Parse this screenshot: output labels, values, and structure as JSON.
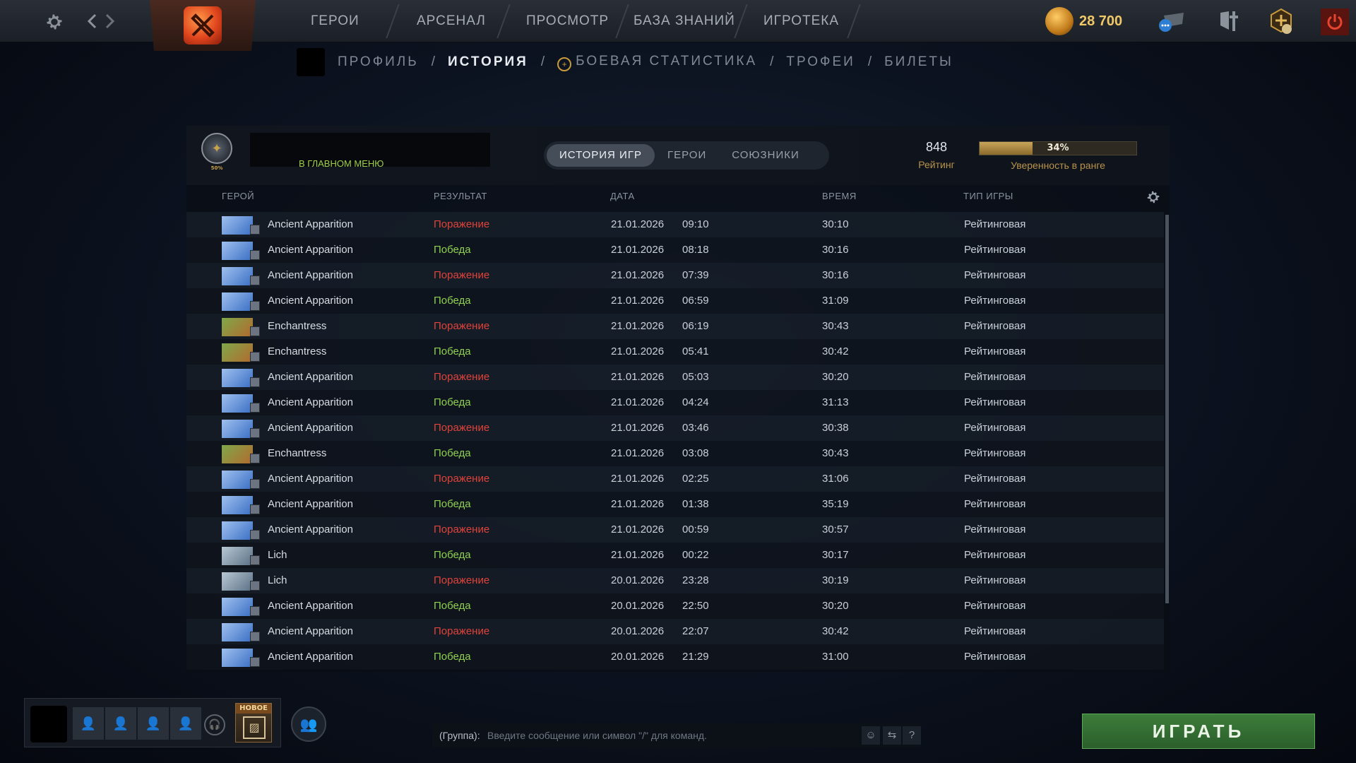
{
  "topbar": {
    "nav": [
      "ГЕРОИ",
      "АРСЕНАЛ",
      "ПРОСМОТР",
      "БАЗА ЗНАНИЙ",
      "ИГРОТЕКА"
    ],
    "currency": "28 700"
  },
  "subnav": {
    "profile": "ПРОФИЛЬ",
    "history": "ИСТОРИЯ",
    "battle_stats": "БОЕВАЯ СТАТИСТИКА",
    "trophies": "ТРОФЕИ",
    "tickets": "БИЛЕТЫ",
    "sep": "/"
  },
  "panel": {
    "medal_percent": "50%",
    "main_menu_link": "В ГЛАВНОМ МЕНЮ",
    "tabs": [
      "ИСТОРИЯ ИГР",
      "ГЕРОИ",
      "СОЮЗНИКИ"
    ],
    "rating_value": "848",
    "rating_label": "Рейтинг",
    "confidence_text": "34%",
    "confidence_value": 0.34,
    "confidence_label": "Уверенность в ранге",
    "columns": {
      "hero": "ГЕРОЙ",
      "result": "РЕЗУЛЬТАТ",
      "date": "ДАТА",
      "duration": "ВРЕМЯ",
      "mode": "ТИП ИГРЫ"
    }
  },
  "matches": [
    {
      "hero": "Ancient Apparition",
      "result": "Поражение",
      "win": false,
      "date": "21.01.2026",
      "time": "09:10",
      "duration": "30:10",
      "mode": "Рейтинговая"
    },
    {
      "hero": "Ancient Apparition",
      "result": "Победа",
      "win": true,
      "date": "21.01.2026",
      "time": "08:18",
      "duration": "30:16",
      "mode": "Рейтинговая"
    },
    {
      "hero": "Ancient Apparition",
      "result": "Поражение",
      "win": false,
      "date": "21.01.2026",
      "time": "07:39",
      "duration": "30:16",
      "mode": "Рейтинговая"
    },
    {
      "hero": "Ancient Apparition",
      "result": "Победа",
      "win": true,
      "date": "21.01.2026",
      "time": "06:59",
      "duration": "31:09",
      "mode": "Рейтинговая"
    },
    {
      "hero": "Enchantress",
      "result": "Поражение",
      "win": false,
      "date": "21.01.2026",
      "time": "06:19",
      "duration": "30:43",
      "mode": "Рейтинговая"
    },
    {
      "hero": "Enchantress",
      "result": "Победа",
      "win": true,
      "date": "21.01.2026",
      "time": "05:41",
      "duration": "30:42",
      "mode": "Рейтинговая"
    },
    {
      "hero": "Ancient Apparition",
      "result": "Поражение",
      "win": false,
      "date": "21.01.2026",
      "time": "05:03",
      "duration": "30:20",
      "mode": "Рейтинговая"
    },
    {
      "hero": "Ancient Apparition",
      "result": "Победа",
      "win": true,
      "date": "21.01.2026",
      "time": "04:24",
      "duration": "31:13",
      "mode": "Рейтинговая"
    },
    {
      "hero": "Ancient Apparition",
      "result": "Поражение",
      "win": false,
      "date": "21.01.2026",
      "time": "03:46",
      "duration": "30:38",
      "mode": "Рейтинговая"
    },
    {
      "hero": "Enchantress",
      "result": "Победа",
      "win": true,
      "date": "21.01.2026",
      "time": "03:08",
      "duration": "30:43",
      "mode": "Рейтинговая"
    },
    {
      "hero": "Ancient Apparition",
      "result": "Поражение",
      "win": false,
      "date": "21.01.2026",
      "time": "02:25",
      "duration": "31:06",
      "mode": "Рейтинговая"
    },
    {
      "hero": "Ancient Apparition",
      "result": "Победа",
      "win": true,
      "date": "21.01.2026",
      "time": "01:38",
      "duration": "35:19",
      "mode": "Рейтинговая"
    },
    {
      "hero": "Ancient Apparition",
      "result": "Поражение",
      "win": false,
      "date": "21.01.2026",
      "time": "00:59",
      "duration": "30:57",
      "mode": "Рейтинговая"
    },
    {
      "hero": "Lich",
      "result": "Победа",
      "win": true,
      "date": "21.01.2026",
      "time": "00:22",
      "duration": "30:17",
      "mode": "Рейтинговая"
    },
    {
      "hero": "Lich",
      "result": "Поражение",
      "win": false,
      "date": "20.01.2026",
      "time": "23:28",
      "duration": "30:19",
      "mode": "Рейтинговая"
    },
    {
      "hero": "Ancient Apparition",
      "result": "Победа",
      "win": true,
      "date": "20.01.2026",
      "time": "22:50",
      "duration": "30:20",
      "mode": "Рейтинговая"
    },
    {
      "hero": "Ancient Apparition",
      "result": "Поражение",
      "win": false,
      "date": "20.01.2026",
      "time": "22:07",
      "duration": "30:42",
      "mode": "Рейтинговая"
    },
    {
      "hero": "Ancient Apparition",
      "result": "Победа",
      "win": true,
      "date": "20.01.2026",
      "time": "21:29",
      "duration": "31:00",
      "mode": "Рейтинговая"
    }
  ],
  "hero_colors": {
    "Ancient Apparition": [
      "#3a6fc4",
      "#9fc0ef"
    ],
    "Enchantress": [
      "#b26a2e",
      "#7fa84a"
    ],
    "Lich": [
      "#5a7085",
      "#b8c8d4"
    ]
  },
  "bottom": {
    "new_badge": "НОВОЕ",
    "chat_prefix": "(Группа):",
    "chat_placeholder": "Введите сообщение или символ \"/\" для команд.",
    "help": "?",
    "play": "ИГРАТЬ"
  },
  "colors": {
    "win": "#8fd14f",
    "loss": "#e0433a",
    "accent_gold": "#b8934a",
    "play_green": "#3c7d3a"
  }
}
